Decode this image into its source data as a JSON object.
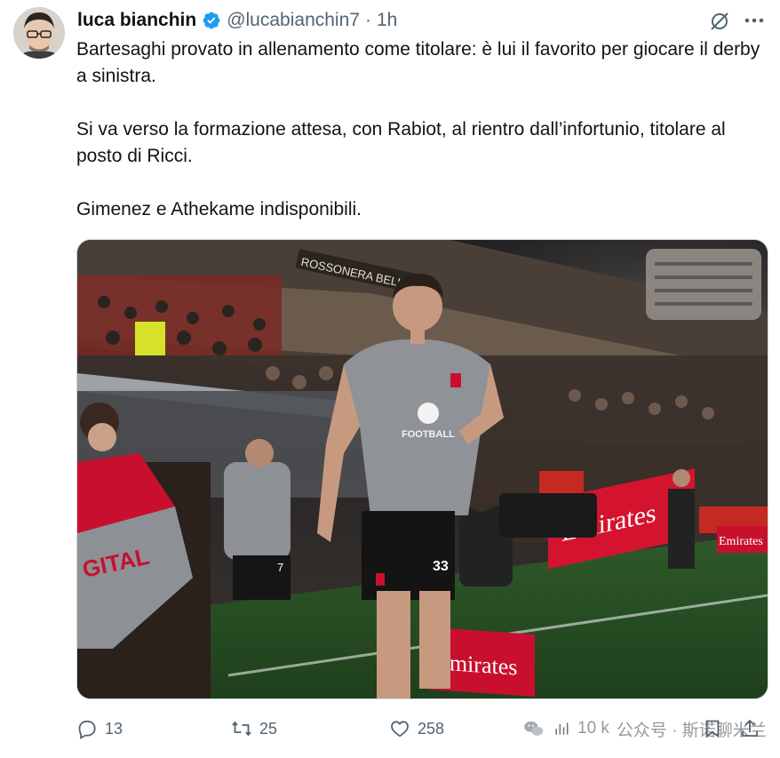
{
  "author": {
    "name": "luca bianchin",
    "handle": "@lucabianchin7",
    "separator": "·",
    "time": "1h"
  },
  "tweet": {
    "paragraphs": [
      "Bartesaghi provato in allenamento come titolare: è lui il favorito per giocare il derby a sinistra.",
      "Si va verso la formazione attesa, con Rabiot, al rientro dall’infortunio, titolare al posto di Ricci.",
      "Gimenez e Athekame indisponibili."
    ]
  },
  "media": {
    "stadium_banner": "ROSSONERA BELLU",
    "ad_board_1": "Emirates",
    "ad_board_2": "Emirates",
    "ad_board_3": "Emirates",
    "shirt_sponsor": "FOOTBALL",
    "player_number": "33",
    "player2_number": "7",
    "bib_text": "GITAL"
  },
  "actions": {
    "replies": "13",
    "reposts": "25",
    "likes": "258",
    "views": "10 k"
  },
  "watermark": {
    "text": "公众号 · 斯诺聊米兰"
  },
  "colors": {
    "verified": "#1d9bf0",
    "text": "#0f1419",
    "muted": "#536471",
    "milan_red": "#c8102e"
  },
  "icons": [
    "verified-badge-icon",
    "grok-icon",
    "more-icon",
    "reply-icon",
    "repost-icon",
    "like-icon",
    "views-icon",
    "bookmark-icon",
    "share-icon",
    "wechat-icon"
  ]
}
